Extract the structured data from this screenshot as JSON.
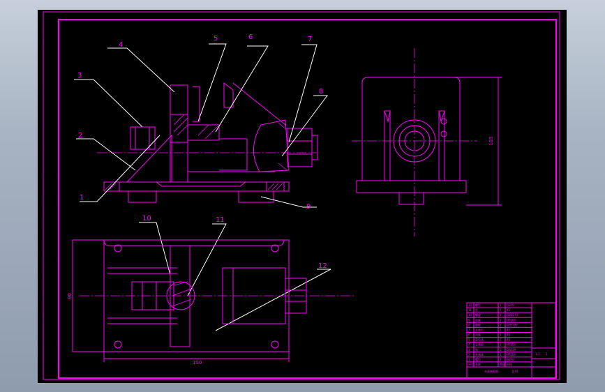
{
  "callouts": [
    "1",
    "2",
    "3",
    "4",
    "5",
    "6",
    "7",
    "8",
    "9",
    "10",
    "11",
    "12"
  ],
  "dimensions": {
    "bottom_width": "150",
    "side_height": "103",
    "left_height": "90"
  },
  "title_block": {
    "scale": "1:1",
    "sheet": "1",
    "rows": [
      [
        "12",
        "螺钉",
        "1",
        "GB70"
      ],
      [
        "11",
        "垫",
        "1",
        "45"
      ],
      [
        "10",
        "螺母",
        "1",
        "GB6170"
      ],
      [
        "9",
        "底座",
        "1",
        "HT200"
      ],
      [
        "8",
        "螺栓",
        "1",
        "GB5782"
      ],
      [
        "7",
        "支承钉",
        "1",
        "45"
      ],
      [
        "6",
        "压板",
        "1",
        "45"
      ],
      [
        "5",
        "定位块",
        "1",
        "45"
      ],
      [
        "4",
        "支承板",
        "1",
        "HT200"
      ],
      [
        "3",
        "销",
        "2",
        "GB119"
      ],
      [
        "2",
        "夹具体",
        "1",
        "HT200"
      ],
      [
        "1",
        "螺钉",
        "4",
        "GB70"
      ]
    ],
    "header": [
      "序号",
      "名称",
      "数量",
      "材料"
    ],
    "drawing_name": "夹具装配图",
    "drawing_no": "JJ-01"
  }
}
